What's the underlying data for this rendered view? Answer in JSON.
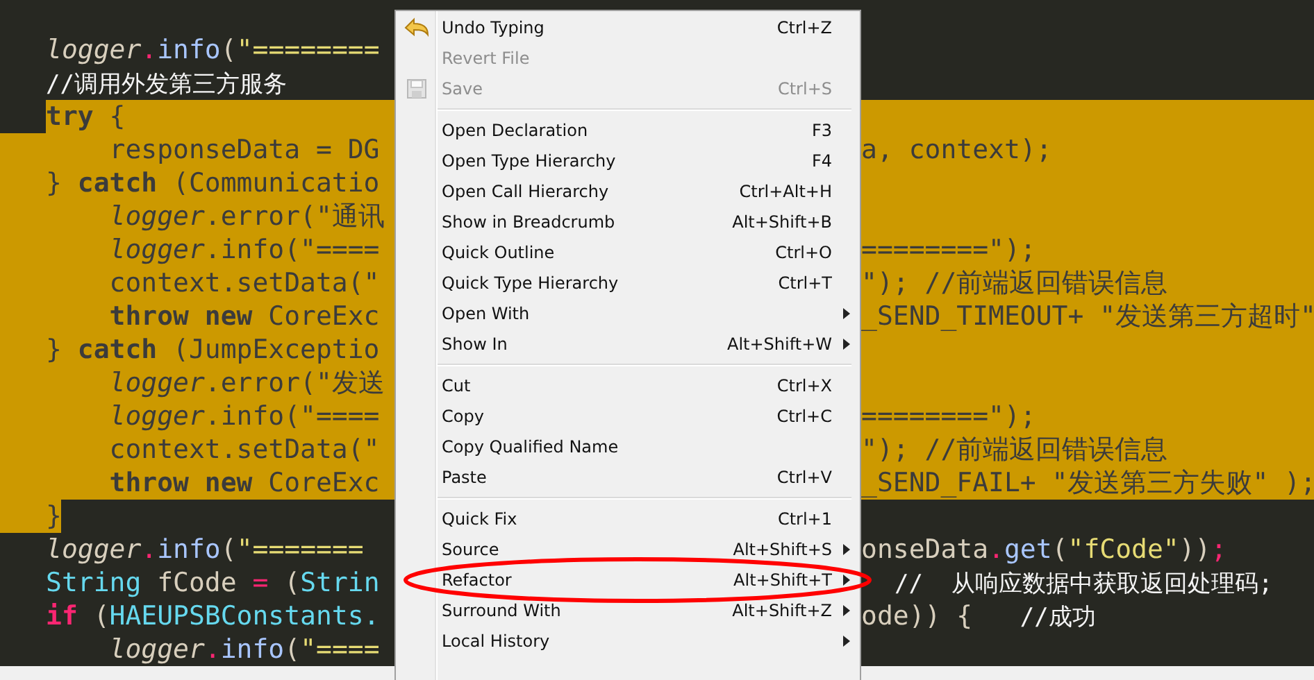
{
  "editor": {
    "lines": [
      {
        "selected": false,
        "left": [
          {
            "kind": "field",
            "text": "logger"
          },
          {
            "kind": "op",
            "text": "."
          },
          {
            "kind": "method",
            "text": "info"
          },
          {
            "kind": "plain",
            "text": "("
          },
          {
            "kind": "str",
            "text": "\"========"
          }
        ]
      },
      {
        "selected": false,
        "left": [
          {
            "kind": "comment",
            "text": "//调用外发第三方服务"
          }
        ]
      },
      {
        "selected": true,
        "left": [
          {
            "kind": "kw",
            "text": "try"
          },
          {
            "kind": "plain",
            "text": " {"
          }
        ]
      },
      {
        "selected": true,
        "left": [
          {
            "kind": "plain",
            "text": "    responseData = DG"
          }
        ],
        "right": [
          {
            "kind": "plain",
            "text": "a, context);"
          }
        ]
      },
      {
        "selected": true,
        "left": [
          {
            "kind": "plain",
            "text": "} "
          },
          {
            "kind": "kw",
            "text": "catch"
          },
          {
            "kind": "plain",
            "text": " (Communicatio"
          }
        ]
      },
      {
        "selected": true,
        "left": [
          {
            "kind": "field",
            "text": "    logger"
          },
          {
            "kind": "plain",
            "text": ".error(\"通讯"
          }
        ]
      },
      {
        "selected": true,
        "left": [
          {
            "kind": "field",
            "text": "    logger"
          },
          {
            "kind": "plain",
            "text": ".info(\"===="
          }
        ],
        "right": [
          {
            "kind": "plain",
            "text": "========\");"
          }
        ]
      },
      {
        "selected": true,
        "left": [
          {
            "kind": "plain",
            "text": "    context.setData(\""
          }
        ],
        "right": [
          {
            "kind": "plain",
            "text": "\"); //前端返回错误信息"
          }
        ]
      },
      {
        "selected": true,
        "left": [
          {
            "kind": "kw",
            "text": "    throw"
          },
          {
            "kind": "kw",
            "text": " new"
          },
          {
            "kind": "plain",
            "text": " CoreExc"
          }
        ],
        "right": [
          {
            "kind": "plain",
            "text": "_SEND_TIMEOUT+ \"发送第三方超时\""
          }
        ]
      },
      {
        "selected": true,
        "left": [
          {
            "kind": "plain",
            "text": "} "
          },
          {
            "kind": "kw",
            "text": "catch"
          },
          {
            "kind": "plain",
            "text": " (JumpExceptio"
          }
        ]
      },
      {
        "selected": true,
        "left": [
          {
            "kind": "field",
            "text": "    logger"
          },
          {
            "kind": "plain",
            "text": ".error(\"发送"
          }
        ]
      },
      {
        "selected": true,
        "left": [
          {
            "kind": "field",
            "text": "    logger"
          },
          {
            "kind": "plain",
            "text": ".info(\"===="
          }
        ],
        "right": [
          {
            "kind": "plain",
            "text": "========\");"
          }
        ]
      },
      {
        "selected": true,
        "left": [
          {
            "kind": "plain",
            "text": "    context.setData(\""
          }
        ],
        "right": [
          {
            "kind": "plain",
            "text": "\"); //前端返回错误信息"
          }
        ]
      },
      {
        "selected": true,
        "left": [
          {
            "kind": "kw",
            "text": "    throw"
          },
          {
            "kind": "kw",
            "text": " new"
          },
          {
            "kind": "plain",
            "text": " CoreExc"
          }
        ],
        "right": [
          {
            "kind": "plain",
            "text": "_SEND_FAIL+ \"发送第三方失败\" );"
          }
        ]
      },
      {
        "selected": true,
        "left": [
          {
            "kind": "plain",
            "text": "}"
          }
        ]
      },
      {
        "selected": false,
        "left": [
          {
            "kind": "field",
            "text": "logger"
          },
          {
            "kind": "op",
            "text": "."
          },
          {
            "kind": "method",
            "text": "info"
          },
          {
            "kind": "plain",
            "text": "("
          },
          {
            "kind": "str",
            "text": "\"======="
          }
        ],
        "right": [
          {
            "kind": "plain",
            "text": "onseData"
          },
          {
            "kind": "op",
            "text": "."
          },
          {
            "kind": "method",
            "text": "get"
          },
          {
            "kind": "plain",
            "text": "("
          },
          {
            "kind": "str",
            "text": "\"fCode\""
          },
          {
            "kind": "plain",
            "text": "))"
          },
          {
            "kind": "op",
            "text": ";"
          }
        ]
      },
      {
        "selected": false,
        "left": [
          {
            "kind": "type",
            "text": "String"
          },
          {
            "kind": "plain",
            "text": " fCode "
          },
          {
            "kind": "op",
            "text": "="
          },
          {
            "kind": "plain",
            "text": " ("
          },
          {
            "kind": "type",
            "text": "Strin"
          }
        ],
        "right": [
          {
            "kind": "comment",
            "text": "//  从响应数据中获取返回处理码;"
          }
        ]
      },
      {
        "selected": false,
        "left": [
          {
            "kind": "kw",
            "text": "if"
          },
          {
            "kind": "plain",
            "text": " ("
          },
          {
            "kind": "type",
            "text": "HAEUPSBConstants."
          }
        ],
        "right": [
          {
            "kind": "plain",
            "text": "ode)) {   "
          },
          {
            "kind": "comment",
            "text": "//成功"
          }
        ]
      },
      {
        "selected": false,
        "left": [
          {
            "kind": "field",
            "text": "    logger"
          },
          {
            "kind": "op",
            "text": "."
          },
          {
            "kind": "method",
            "text": "info"
          },
          {
            "kind": "plain",
            "text": "("
          },
          {
            "kind": "str",
            "text": "\"===="
          }
        ]
      }
    ]
  },
  "menu": {
    "groups": [
      {
        "items": [
          {
            "label": "Undo Typing",
            "shortcut": "Ctrl+Z",
            "disabled": false,
            "submenu": false
          },
          {
            "label": "Revert File",
            "disabled": true,
            "submenu": false
          },
          {
            "label": "Save",
            "shortcut": "Ctrl+S",
            "disabled": true,
            "submenu": false
          }
        ]
      },
      {
        "items": [
          {
            "label": "Open Declaration",
            "shortcut": "F3",
            "disabled": false,
            "submenu": false
          },
          {
            "label": "Open Type Hierarchy",
            "shortcut": "F4",
            "disabled": false,
            "submenu": false
          },
          {
            "label": "Open Call Hierarchy",
            "shortcut": "Ctrl+Alt+H",
            "disabled": false,
            "submenu": false
          },
          {
            "label": "Show in Breadcrumb",
            "shortcut": "Alt+Shift+B",
            "disabled": false,
            "submenu": false
          },
          {
            "label": "Quick Outline",
            "shortcut": "Ctrl+O",
            "disabled": false,
            "submenu": false
          },
          {
            "label": "Quick Type Hierarchy",
            "shortcut": "Ctrl+T",
            "disabled": false,
            "submenu": false
          },
          {
            "label": "Open With",
            "disabled": false,
            "submenu": true
          },
          {
            "label": "Show In",
            "shortcut": "Alt+Shift+W",
            "disabled": false,
            "submenu": true
          }
        ]
      },
      {
        "items": [
          {
            "label": "Cut",
            "shortcut": "Ctrl+X",
            "disabled": false,
            "submenu": false
          },
          {
            "label": "Copy",
            "shortcut": "Ctrl+C",
            "disabled": false,
            "submenu": false
          },
          {
            "label": "Copy Qualified Name",
            "disabled": false,
            "submenu": false
          },
          {
            "label": "Paste",
            "shortcut": "Ctrl+V",
            "disabled": false,
            "submenu": false
          }
        ]
      },
      {
        "items": [
          {
            "label": "Quick Fix",
            "shortcut": "Ctrl+1",
            "disabled": false,
            "submenu": false
          },
          {
            "label": "Source",
            "shortcut": "Alt+Shift+S",
            "disabled": false,
            "submenu": true
          },
          {
            "label": "Refactor",
            "shortcut": "Alt+Shift+T",
            "disabled": false,
            "submenu": true
          },
          {
            "label": "Surround With",
            "shortcut": "Alt+Shift+Z",
            "disabled": false,
            "submenu": true
          },
          {
            "label": "Local History",
            "disabled": false,
            "submenu": true
          }
        ]
      }
    ]
  },
  "annotation": {
    "kind": "ellipse",
    "color": "#ff0000"
  }
}
